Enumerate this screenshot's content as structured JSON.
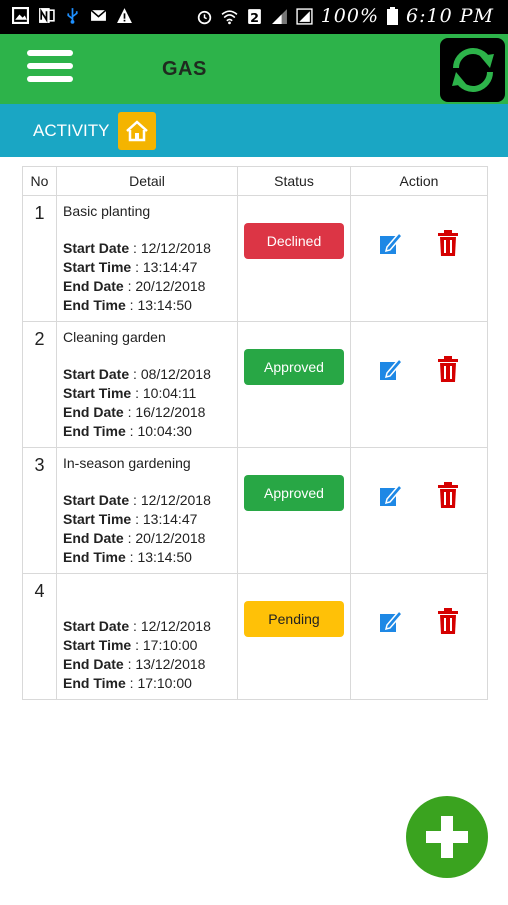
{
  "status_bar": {
    "time": "6:10 PM",
    "battery": "100%",
    "icons": [
      "image-icon",
      "onenote-icon",
      "usb-icon",
      "mail-icon",
      "warning-icon",
      "alarm-icon",
      "wifi-icon",
      "sim2-icon",
      "signal-icon",
      "signal-icon"
    ]
  },
  "header": {
    "title": "GAS",
    "menu_icon": "hamburger-menu-icon",
    "refresh_icon": "refresh-icon",
    "bg_color": "#2db34a"
  },
  "activity_bar": {
    "label": "ACTIVITY",
    "home_icon": "home-icon",
    "bg_color": "#1aa6c4"
  },
  "table": {
    "columns": [
      "No",
      "Detail",
      "Status",
      "Action"
    ],
    "labels": {
      "start_date": "Start Date",
      "start_time": "Start Time",
      "end_date": "End Date",
      "end_time": "End Time"
    },
    "rows": [
      {
        "no": "1",
        "title": "Basic planting",
        "start_date": "12/12/2018",
        "start_time": "13:14:47",
        "end_date": "20/12/2018",
        "end_time": "13:14:50",
        "status": "Declined",
        "status_kind": "declined"
      },
      {
        "no": "2",
        "title": "Cleaning garden",
        "start_date": "08/12/2018",
        "start_time": "10:04:11",
        "end_date": "16/12/2018",
        "end_time": "10:04:30",
        "status": "Approved",
        "status_kind": "approved"
      },
      {
        "no": "3",
        "title": "In-season gardening",
        "start_date": "12/12/2018",
        "start_time": "13:14:47",
        "end_date": "20/12/2018",
        "end_time": "13:14:50",
        "status": "Approved",
        "status_kind": "approved"
      },
      {
        "no": "4",
        "title": "",
        "start_date": "12/12/2018",
        "start_time": "17:10:00",
        "end_date": "13/12/2018",
        "end_time": "17:10:00",
        "status": "Pending",
        "status_kind": "pending"
      }
    ],
    "action_icons": [
      "edit-icon",
      "trash-icon"
    ],
    "colors": {
      "declined": "#dc3545",
      "approved": "#28a745",
      "pending": "#ffc107",
      "edit": "#1e88e5",
      "delete": "#d50000"
    }
  },
  "fab": {
    "icon": "plus-icon",
    "color": "#3aa31f"
  }
}
